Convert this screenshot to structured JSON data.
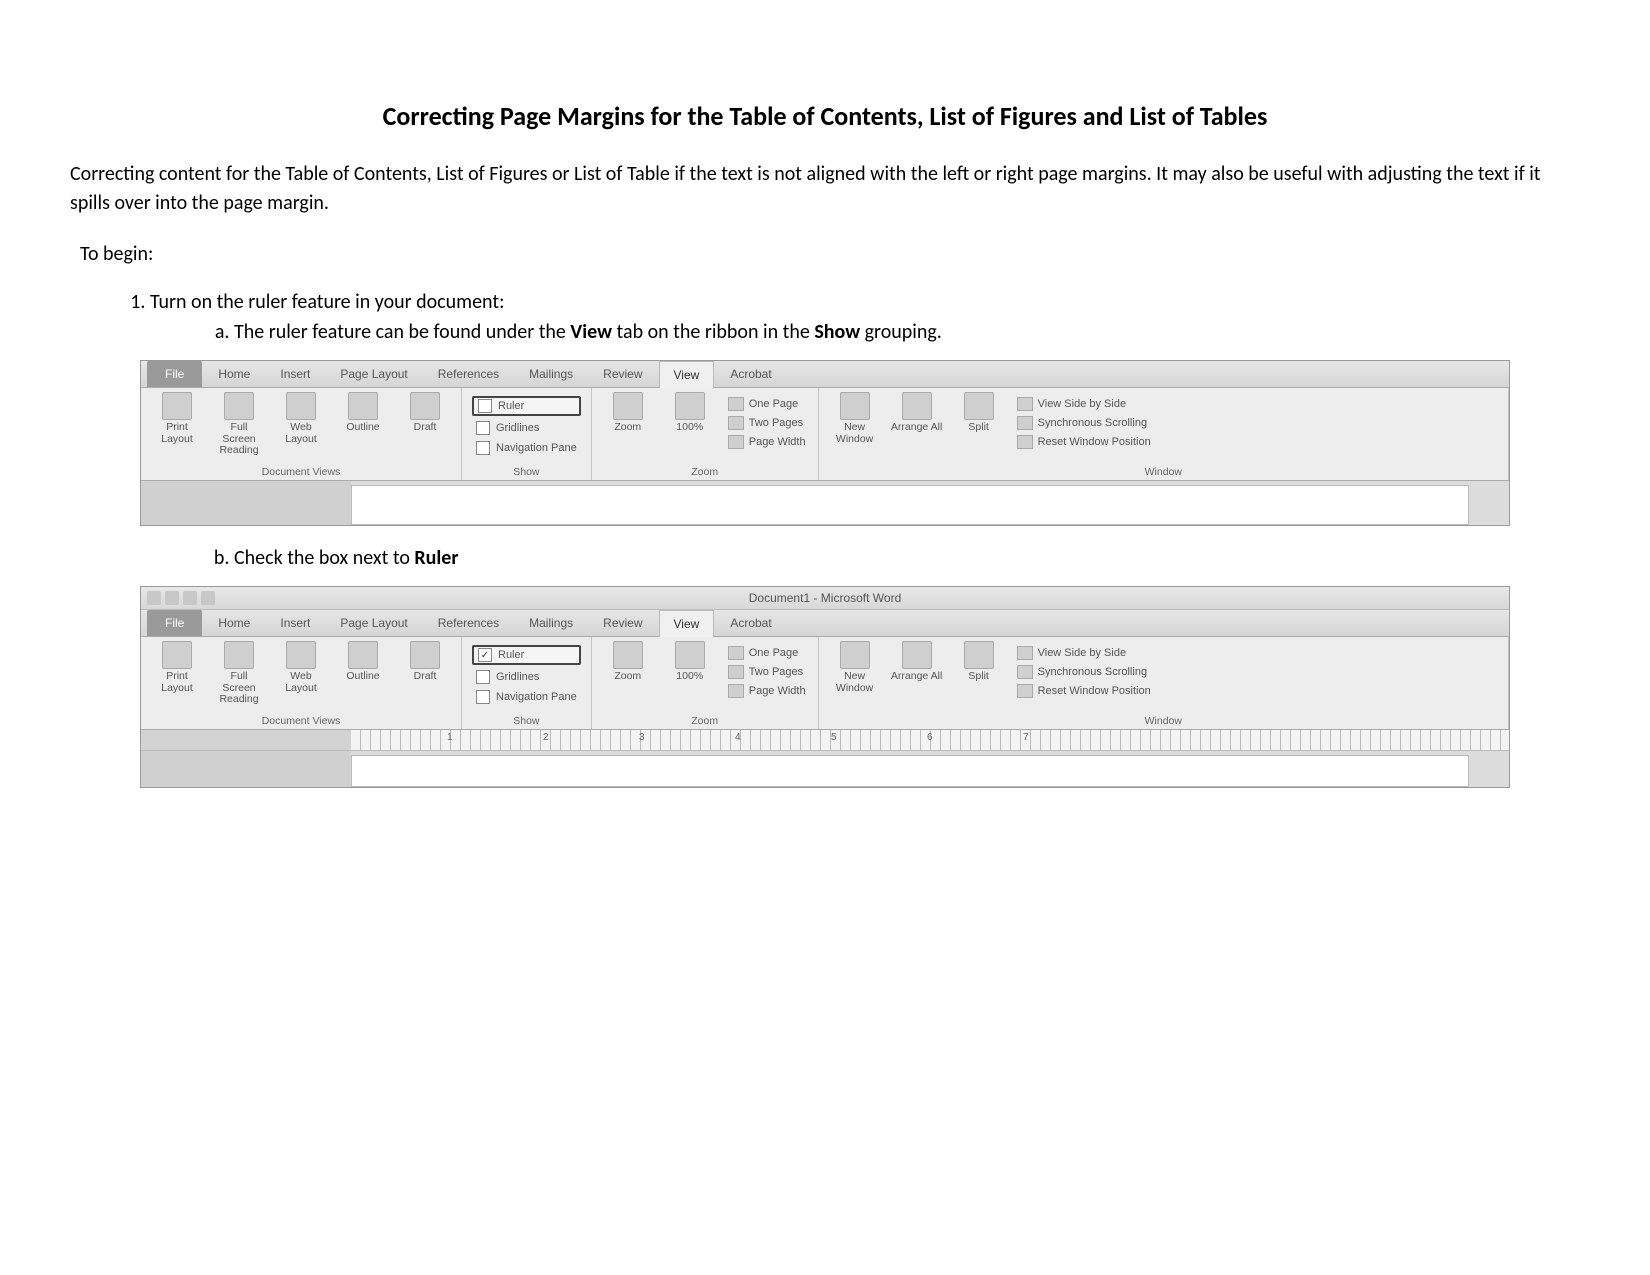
{
  "title": "Correcting Page Margins for the Table of Contents, List of Figures and List of Tables",
  "intro": "Correcting content for the Table of Contents, List of Figures or List of Table if the text is not aligned with the left or right page margins. It may also be useful with adjusting the text if it spills over into the page margin.",
  "to_begin": "To begin:",
  "step1": "Turn on the ruler feature in your document:",
  "step1a_pre": "The ruler feature can be found under the ",
  "step1a_view": "View",
  "step1a_mid": " tab on the ribbon in the ",
  "step1a_show": "Show",
  "step1a_post": " grouping.",
  "step1b_pre": "Check the box next to ",
  "step1b_ruler": "Ruler",
  "ribbon": {
    "file": "File",
    "tabs": [
      "Home",
      "Insert",
      "Page Layout",
      "References",
      "Mailings",
      "Review",
      "View",
      "Acrobat"
    ],
    "doc_views": {
      "label": "Document Views",
      "buttons": [
        {
          "l1": "Print",
          "l2": "Layout"
        },
        {
          "l1": "Full Screen",
          "l2": "Reading"
        },
        {
          "l1": "Web",
          "l2": "Layout"
        },
        {
          "l1": "Outline",
          "l2": ""
        },
        {
          "l1": "Draft",
          "l2": ""
        }
      ]
    },
    "show": {
      "label": "Show",
      "ruler": "Ruler",
      "gridlines": "Gridlines",
      "nav": "Navigation Pane"
    },
    "zoom": {
      "label": "Zoom",
      "zoom": "Zoom",
      "hundred": "100%",
      "one_page": "One Page",
      "two_pages": "Two Pages",
      "page_width": "Page Width"
    },
    "window": {
      "label": "Window",
      "new": "New Window",
      "arrange": "Arrange All",
      "split": "Split",
      "side": "View Side by Side",
      "sync": "Synchronous Scrolling",
      "reset": "Reset Window Position"
    }
  },
  "titlebar": "Document1 - Microsoft Word",
  "ruler_nums": [
    "1",
    "2",
    "3",
    "4",
    "5",
    "6",
    "7"
  ]
}
